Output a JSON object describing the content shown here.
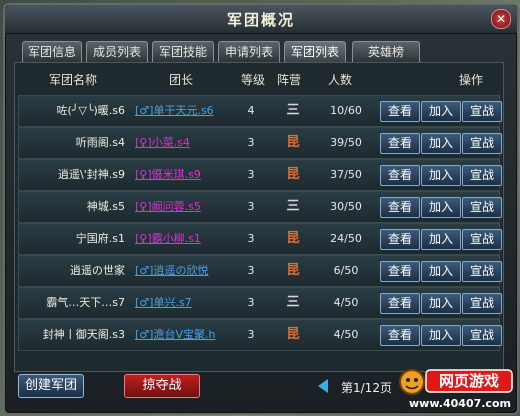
{
  "window": {
    "title": "军团概况",
    "close_symbol": "✕"
  },
  "tabs": [
    {
      "label": "军团信息",
      "active": false
    },
    {
      "label": "成员列表",
      "active": false
    },
    {
      "label": "军团技能",
      "active": false
    },
    {
      "label": "申请列表",
      "active": false
    },
    {
      "label": "军团列表",
      "active": true
    },
    {
      "label": "英雄榜",
      "active": false
    }
  ],
  "columns": {
    "name": "军团名称",
    "leader": "团长",
    "level": "等级",
    "camp": "阵营",
    "members": "人数",
    "actions": "操作"
  },
  "buttons": {
    "view": "查看",
    "join": "加入",
    "war": "宣战"
  },
  "rows": [
    {
      "name": "咗(╯▽╰)暖.s6",
      "leader": "[♂]单干天元.s6",
      "gender": "male",
      "level": "4",
      "camp": "三",
      "members": "10/60"
    },
    {
      "name": "听雨阁.s4",
      "leader": "[♀]小菜.s4",
      "gender": "female",
      "level": "3",
      "camp": "昆",
      "members": "39/50"
    },
    {
      "name": "逍遥\\'封神.s9",
      "leader": "[♀]慑米琪.s9",
      "gender": "female",
      "level": "3",
      "camp": "昆",
      "members": "37/50"
    },
    {
      "name": "神城.s5",
      "leader": "[♀]阚问蓉.s5",
      "gender": "female",
      "level": "3",
      "camp": "三",
      "members": "30/50"
    },
    {
      "name": "宁国府.s1",
      "leader": "[♀]霸小柳.s1",
      "gender": "female",
      "level": "3",
      "camp": "昆",
      "members": "24/50"
    },
    {
      "name": "逍遥の世家",
      "leader": "[♂]逍遥の欣悦",
      "gender": "male",
      "level": "3",
      "camp": "昆",
      "members": "6/50"
    },
    {
      "name": "霸气…天下…s7",
      "leader": "[♂]单兴.s7",
      "gender": "male",
      "level": "3",
      "camp": "三",
      "members": "4/50"
    },
    {
      "name": "封神丨御天阁.s3",
      "leader": "[♂]澹台V宝聚.h",
      "gender": "male",
      "level": "3",
      "camp": "昆",
      "members": "4/50"
    }
  ],
  "footer": {
    "create": "创建军团",
    "plunder": "掠夺战",
    "page": "第1/12页"
  },
  "logo": {
    "main": "网页游戏",
    "url": "www.40407.com"
  },
  "colors": {
    "camp_kun": "#e07030",
    "camp_san": "#d8d8d8",
    "male": "#4aa0e8",
    "female": "#e030d0",
    "plunder": "#c02020",
    "accent": "#3a5a7a"
  }
}
